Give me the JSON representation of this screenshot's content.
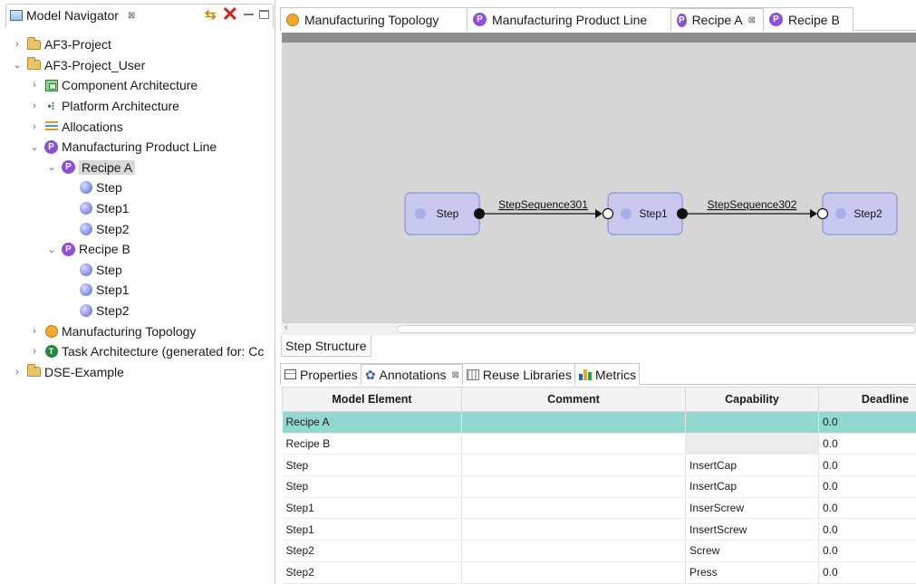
{
  "navigator": {
    "title": "Model Navigator",
    "close_glyph": "⊠",
    "tree": [
      {
        "label": "AF3-Project",
        "icon": "folder-icon",
        "chevron": "›",
        "depth": 0
      },
      {
        "label": "AF3-Project_User",
        "icon": "folder-icon",
        "chevron": "⌄",
        "depth": 0
      },
      {
        "label": "Component Architecture",
        "icon": "component-architecture-icon",
        "chevron": "›",
        "depth": 1
      },
      {
        "label": "Platform Architecture",
        "icon": "platform-architecture-icon",
        "chevron": "›",
        "depth": 1
      },
      {
        "label": "Allocations",
        "icon": "allocations-icon",
        "chevron": "›",
        "depth": 1
      },
      {
        "label": "Manufacturing Product Line",
        "icon": "product-line-icon",
        "chevron": "⌄",
        "depth": 1
      },
      {
        "label": "Recipe A",
        "icon": "product-line-icon",
        "chevron": "⌄",
        "depth": 2,
        "selected": true
      },
      {
        "label": "Step",
        "icon": "step-icon",
        "chevron": "",
        "depth": 3
      },
      {
        "label": "Step1",
        "icon": "step-icon",
        "chevron": "",
        "depth": 3
      },
      {
        "label": "Step2",
        "icon": "step-icon",
        "chevron": "",
        "depth": 3
      },
      {
        "label": "Recipe B",
        "icon": "product-line-icon",
        "chevron": "⌄",
        "depth": 2
      },
      {
        "label": "Step",
        "icon": "step-icon",
        "chevron": "",
        "depth": 3
      },
      {
        "label": "Step1",
        "icon": "step-icon",
        "chevron": "",
        "depth": 3
      },
      {
        "label": "Step2",
        "icon": "step-icon",
        "chevron": "",
        "depth": 3
      },
      {
        "label": "Manufacturing Topology",
        "icon": "topology-icon",
        "chevron": "›",
        "depth": 1
      },
      {
        "label": "Task Architecture (generated for: Cc",
        "icon": "task-architecture-icon",
        "chevron": "›",
        "depth": 1
      },
      {
        "label": "DSE-Example",
        "icon": "folder-icon",
        "chevron": "›",
        "depth": 0
      }
    ],
    "p_letter": "P",
    "task_letter": "T"
  },
  "editor": {
    "tabs": [
      {
        "label": "Manufacturing Topology",
        "icon": "topology-icon"
      },
      {
        "label": "Manufacturing Product Line",
        "icon": "product-line-icon"
      },
      {
        "label": "Recipe A",
        "icon": "product-line-icon",
        "active": true,
        "close": "⊠"
      },
      {
        "label": "Recipe B",
        "icon": "product-line-icon"
      }
    ],
    "diagram": {
      "nodes": [
        "Step",
        "Step1",
        "Step2"
      ],
      "edges": [
        "StepSequence301",
        "StepSequence302"
      ]
    },
    "bottom_tab": "Step Structure",
    "scroll_arrow": "‹"
  },
  "views": {
    "tabs": [
      {
        "label": "Properties",
        "icon": "properties-icon"
      },
      {
        "label": "Annotations",
        "icon": "gear-icon",
        "active": true,
        "close": "⊠"
      },
      {
        "label": "Reuse Libraries",
        "icon": "library-icon"
      },
      {
        "label": "Metrics",
        "icon": "metrics-icon"
      }
    ],
    "table": {
      "columns": [
        "Model Element",
        "Comment",
        "Capability",
        "Deadline"
      ],
      "rows": [
        {
          "element": "Recipe A",
          "comment": "",
          "capability": "",
          "deadline": "0.0",
          "selected": true
        },
        {
          "element": "Recipe B",
          "comment": "",
          "capability": "",
          "deadline": "0.0"
        },
        {
          "element": "Step",
          "comment": "",
          "capability": "InsertCap",
          "deadline": "0.0"
        },
        {
          "element": "Step",
          "comment": "",
          "capability": "InsertCap",
          "deadline": "0.0"
        },
        {
          "element": "Step1",
          "comment": "",
          "capability": "InserScrew",
          "deadline": "0.0"
        },
        {
          "element": "Step1",
          "comment": "",
          "capability": "InsertScrew",
          "deadline": "0.0"
        },
        {
          "element": "Step2",
          "comment": "",
          "capability": "Screw",
          "deadline": "0.0"
        },
        {
          "element": "Step2",
          "comment": "",
          "capability": "Press",
          "deadline": "0.0"
        }
      ]
    }
  },
  "colors": {
    "accent_purple": "#8b4fd8",
    "selection_teal": "#93d8d0",
    "canvas_gray": "#d6d6d6",
    "node_fill": "#c9c9f0",
    "node_border": "#7a86d8"
  }
}
